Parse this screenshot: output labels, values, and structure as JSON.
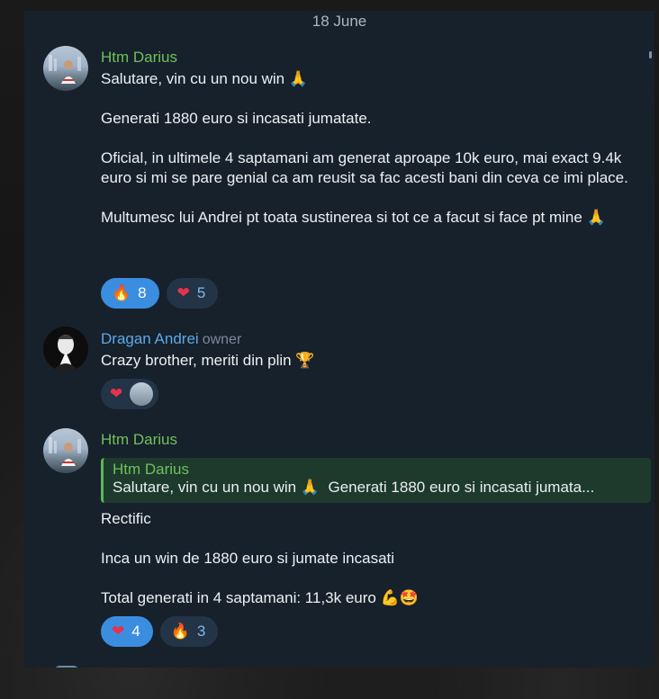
{
  "date_divider": "18 June",
  "messages": [
    {
      "author": "Htm Darius",
      "lines": [
        "Salutare, vin cu un nou win",
        "Generati 1880 euro si incasati jumatate.",
        "Oficial, in ultimele 4 saptamani am generat aproape 10k euro, mai exact 9.4k euro si mi se pare genial ca am reusit sa fac acesti bani din ceva ce imi place.",
        "Multumesc lui Andrei pt toata sustinerea si tot ce a facut si face pt mine"
      ],
      "reactions": [
        {
          "icon": "fire-icon",
          "count": "8",
          "active": true
        },
        {
          "icon": "heart-icon",
          "count": "5",
          "active": false
        }
      ]
    },
    {
      "author": "Dragan Andrei",
      "role": "owner",
      "lines": [
        "Crazy brother, meriti din plin"
      ],
      "reactions": [
        {
          "icon": "heart-icon"
        }
      ]
    },
    {
      "author": "Htm Darius",
      "reply": {
        "author": "Htm Darius",
        "text_a": "Salutare, vin cu un nou win",
        "text_b": "Generati 1880 euro si incasati jumata..."
      },
      "lines": [
        "Rectific",
        "Inca un win de 1880 euro si jumate incasati",
        "Total generati in 4 saptamani: 11,3k euro"
      ],
      "reactions": [
        {
          "icon": "heart-icon",
          "count": "4",
          "active": true
        },
        {
          "icon": "fire-icon",
          "count": "3",
          "active": false
        }
      ]
    }
  ],
  "colors": {
    "panel": "#17212b",
    "name_green": "#6fc05a",
    "name_blue": "#5ba9e6",
    "reaction_active": "#3b8de0"
  }
}
